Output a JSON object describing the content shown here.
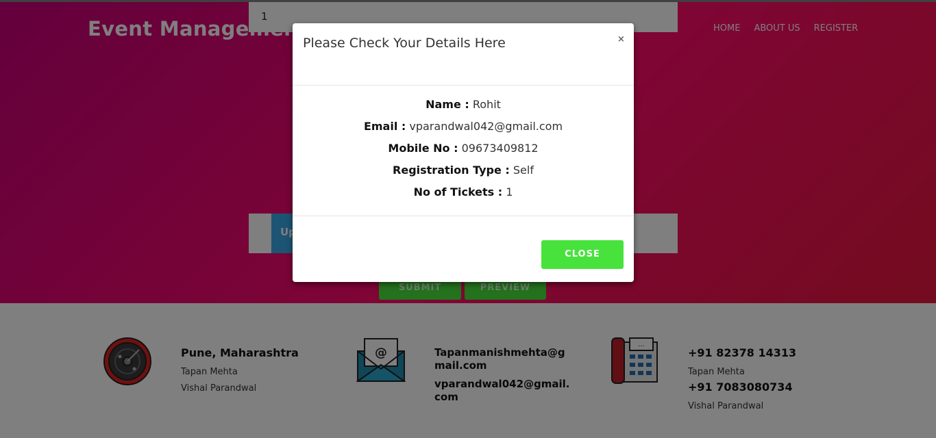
{
  "header": {
    "brand": "Event Management.",
    "nav": [
      "HOME",
      "ABOUT US",
      "REGISTER"
    ]
  },
  "form": {
    "tickets_value": "1",
    "upload_label": "Up",
    "submit_label": "SUBMIT",
    "preview_label": "PREVIEW"
  },
  "footer": {
    "location": {
      "title": "Pune, Maharashtra",
      "lines": [
        "Tapan Mehta",
        "Vishal Parandwal"
      ],
      "icon": "location-icon"
    },
    "email": {
      "lines": [
        "Tapanmanishmehta@g",
        "mail.com",
        "vparandwal042@gmail.",
        "com"
      ],
      "icon": "envelope-icon"
    },
    "phone": {
      "phone1": "+91 82378 14313",
      "name1": "Tapan Mehta",
      "phone2": "+91 7083080734",
      "name2": "Vishal Parandwal",
      "icon": "telephone-icon"
    }
  },
  "modal": {
    "title": "Please Check Your Details Here",
    "close_x": "×",
    "details": [
      {
        "label": "Name :",
        "value": "Rohit"
      },
      {
        "label": "Email :",
        "value": "vparandwal042@gmail.com"
      },
      {
        "label": "Mobile No :",
        "value": "09673409812"
      },
      {
        "label": "Registration Type :",
        "value": "Self"
      },
      {
        "label": "No of Tickets :",
        "value": "1"
      }
    ],
    "close_label": "CLOSE"
  },
  "colors": {
    "accent_green": "#48e23c",
    "hero_pink": "#ff0a6b"
  }
}
